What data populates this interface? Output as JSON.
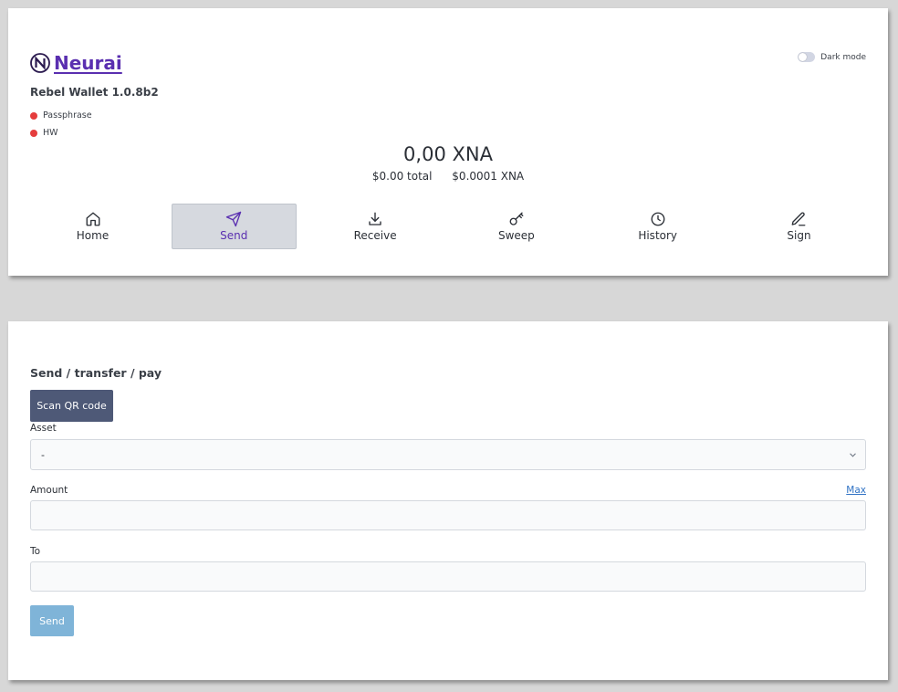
{
  "header": {
    "brand_name": "Neurai",
    "wallet_version": "Rebel Wallet 1.0.8b2",
    "status_items": [
      {
        "label": "Passphrase",
        "state_color": "#e53d3d"
      },
      {
        "label": "HW",
        "state_color": "#e53d3d"
      }
    ],
    "dark_mode_label": "Dark mode",
    "dark_mode_enabled": false,
    "brand_color": "#5a2fb0"
  },
  "balance": {
    "main": "0,00 XNA",
    "total_usd": "$0.00 total",
    "price": "$0.0001 XNA"
  },
  "nav": {
    "active": "Send",
    "items": [
      {
        "label": "Home",
        "icon": "home-icon"
      },
      {
        "label": "Send",
        "icon": "send-icon"
      },
      {
        "label": "Receive",
        "icon": "download-icon"
      },
      {
        "label": "Sweep",
        "icon": "key-icon"
      },
      {
        "label": "History",
        "icon": "clock-icon"
      },
      {
        "label": "Sign",
        "icon": "pen-icon"
      }
    ]
  },
  "send_form": {
    "title": "Send / transfer / pay",
    "scan_button": "Scan QR code",
    "asset_label": "Asset",
    "asset_value": "-",
    "amount_label": "Amount",
    "max_link": "Max",
    "amount_value": "",
    "to_label": "To",
    "to_value": "",
    "send_button": "Send"
  }
}
